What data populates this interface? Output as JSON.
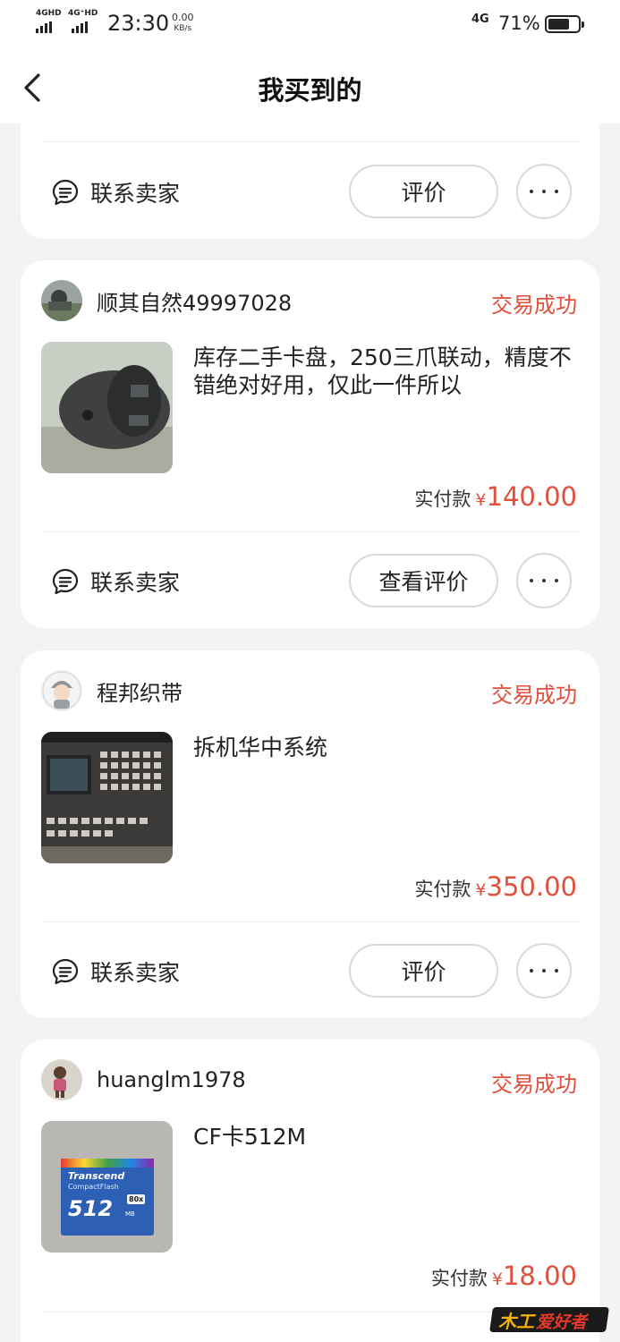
{
  "status_bar": {
    "sig1": "4GHD",
    "sig2": "4G⁺HD",
    "time": "23:30",
    "speed_val": "0.00",
    "speed_unit": "KB/s",
    "net": "4G",
    "battery": "71%",
    "battery_level": 0.71
  },
  "nav": {
    "title": "我买到的",
    "back_icon": "chevron-left-icon"
  },
  "common": {
    "contact_label": "联系卖家",
    "paid_label": "实付款",
    "currency": "¥",
    "accent": "#e0503c"
  },
  "orders": [
    {
      "action_label": "评价"
    },
    {
      "seller": "顺其自然49997028",
      "status": "交易成功",
      "title": "库存二手卡盘，250三爪联动，精度不错绝对好用，仅此一件所以",
      "amount": "140.00",
      "action_label": "查看评价"
    },
    {
      "seller": "程邦织带",
      "status": "交易成功",
      "title": "拆机华中系统",
      "amount": "350.00",
      "action_label": "评价"
    },
    {
      "seller": "huanglm1978",
      "status": "交易成功",
      "title": "CF卡512M",
      "amount": "18.00",
      "thumb_brand": "Transcend",
      "thumb_line": "CompactFlash",
      "thumb_size": "512",
      "thumb_unit": "MB",
      "thumb_speed": "80x"
    }
  ],
  "watermark": {
    "part1": "木工",
    "part2": "爱好者"
  }
}
